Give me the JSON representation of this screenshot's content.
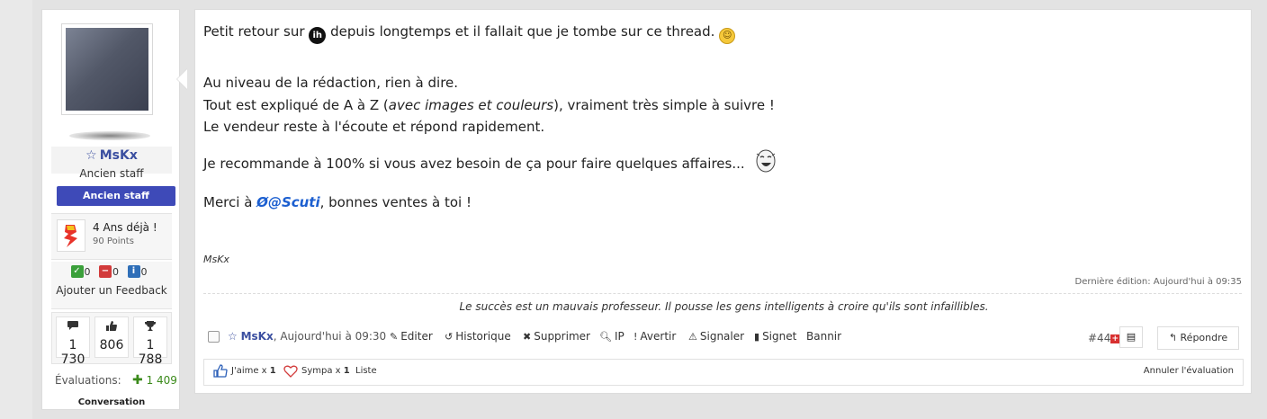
{
  "user": {
    "name": "MsKx",
    "star_icon": "☆",
    "title": "Ancien staff",
    "badge": "Ancien staff",
    "badge_color": "#3e4ab8",
    "trophy": {
      "title": "4 Ans déjà !",
      "points": "90 Points",
      "icon": "trophy-badge-icon"
    },
    "feedback": {
      "positive": "0",
      "negative": "0",
      "neutral": "0",
      "link": "Ajouter un Feedback"
    },
    "stats": [
      {
        "icon": "messages-icon",
        "value": "1 730"
      },
      {
        "icon": "likes-icon",
        "value": "806"
      },
      {
        "icon": "trophy-icon",
        "value": "1 788"
      }
    ],
    "ratings_label": "Évaluations:",
    "ratings_value": "1 409",
    "conversation_label": "Conversation"
  },
  "post": {
    "line1_a": "Petit retour sur",
    "line1_logo": "ih",
    "line1_b": "depuis longtemps et il fallait que je tombe sur ce thread.",
    "line2": "Au niveau de la rédaction, rien à dire.",
    "line3_a": "Tout est expliqué de A à Z (",
    "line3_em": "avec images et couleurs",
    "line3_b": "), vraiment très simple à suivre !",
    "line4": "Le vendeur reste à l'écoute et répond rapidement.",
    "line5": "Je recommande à 100% si vous avez besoin de ça pour faire quelques affaires...",
    "line6_a": "Merci à",
    "line6_mention": "@Scuti",
    "line6_b": ", bonnes ventes à toi !",
    "signature_name": "MsKx",
    "last_edit": "Dernière édition: Aujourd'hui à 09:35",
    "signature_quote": "Le succès est un mauvais professeur. Il pousse les gens intelligents à croire qu'ils sont infaillibles."
  },
  "actions": {
    "author": "MsKx",
    "time": ", Aujourd'hui à 09:30",
    "edit": "Editer",
    "history": "Historique",
    "delete": "Supprimer",
    "ip": "IP",
    "warn": "Avertir",
    "report": "Signaler",
    "bookmark": "Signet",
    "ban": "Bannir",
    "post_number": "#44",
    "reply": "Répondre"
  },
  "likes": {
    "like_label": "J'aime x",
    "like_count": "1",
    "sympa_label": "Sympa x",
    "sympa_count": "1",
    "list": "Liste",
    "undo": "Annuler l'évaluation"
  }
}
